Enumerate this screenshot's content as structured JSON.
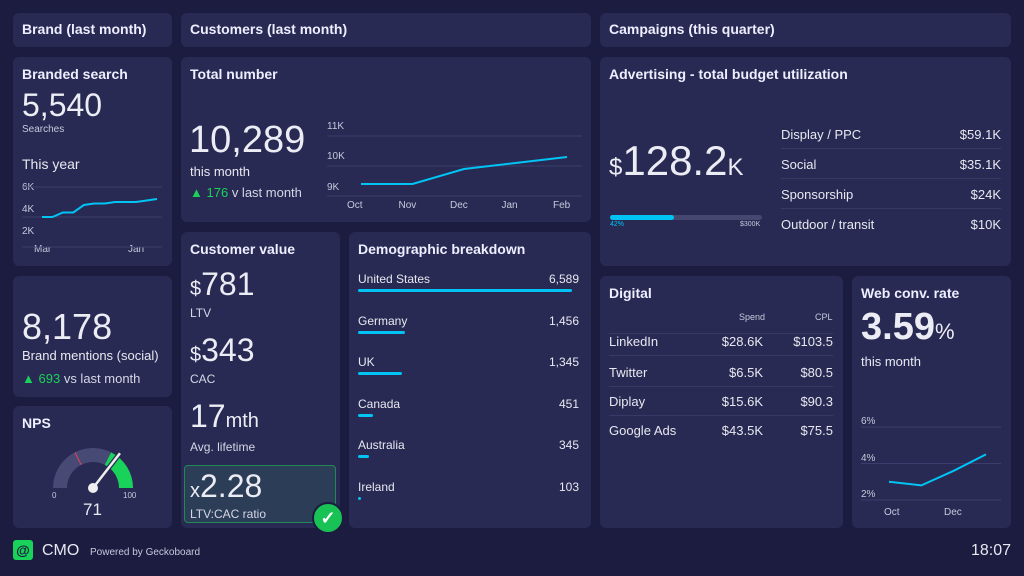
{
  "headers": {
    "brand": "Brand (last month)",
    "customers": "Customers (last month)",
    "campaigns": "Campaigns (this quarter)"
  },
  "branded_search": {
    "title": "Branded search",
    "value": "5,540",
    "unit": "Searches",
    "subtitle": "This year",
    "chart_data": {
      "type": "line",
      "x_labels": [
        "Mar",
        "Jan"
      ],
      "y_ticks": [
        "6K",
        "4K",
        "2K"
      ],
      "ylim": [
        2000,
        6000
      ],
      "values": [
        4000,
        4000,
        4300,
        4300,
        4800,
        4900,
        4900,
        5000,
        5000,
        5000,
        5100,
        5200
      ]
    }
  },
  "brand_mentions": {
    "value": "8,178",
    "label": "Brand mentions (social)",
    "delta": "693",
    "delta_text": "vs last month"
  },
  "nps": {
    "title": "NPS",
    "value": "71",
    "min": "0",
    "max": "100",
    "green_from": 65,
    "red_marker": 35
  },
  "total_number": {
    "title": "Total number",
    "value": "10,289",
    "label": "this month",
    "delta": "176",
    "delta_text": "v last month",
    "chart_data": {
      "type": "line",
      "categories": [
        "Oct",
        "Nov",
        "Dec",
        "Jan",
        "Feb"
      ],
      "y_ticks": [
        "11K",
        "10K",
        "9K"
      ],
      "ylim": [
        9000,
        11000
      ],
      "values": [
        9400,
        9400,
        9900,
        10100,
        10300
      ]
    }
  },
  "customer_value": {
    "title": "Customer value",
    "ltv": "781",
    "ltv_label": "LTV",
    "cac": "343",
    "cac_label": "CAC",
    "lifetime": "17",
    "lifetime_unit": "mth",
    "lifetime_label": "Avg. lifetime",
    "ratio_prefix": "x",
    "ratio": "2.28",
    "ratio_label": "LTV:CAC ratio",
    "currency": "$"
  },
  "demographic": {
    "title": "Demographic breakdown",
    "items": [
      {
        "label": "United States",
        "value": "6,589",
        "n": 6589
      },
      {
        "label": "Germany",
        "value": "1,456",
        "n": 1456
      },
      {
        "label": "UK",
        "value": "1,345",
        "n": 1345
      },
      {
        "label": "Canada",
        "value": "451",
        "n": 451
      },
      {
        "label": "Australia",
        "value": "345",
        "n": 345
      },
      {
        "label": "Ireland",
        "value": "103",
        "n": 103
      }
    ]
  },
  "advertising": {
    "title": "Advertising - total budget utilization",
    "currency": "$",
    "value": "128.2",
    "suffix": "K",
    "progress_pct": 42,
    "progress_label": "42%",
    "target": "$300K",
    "rows": [
      {
        "label": "Display / PPC",
        "value": "$59.1K"
      },
      {
        "label": "Social",
        "value": "$35.1K"
      },
      {
        "label": "Sponsorship",
        "value": "$24K"
      },
      {
        "label": "Outdoor / transit",
        "value": "$10K"
      }
    ]
  },
  "digital": {
    "title": "Digital",
    "columns": [
      "Spend",
      "CPL"
    ],
    "rows": [
      {
        "label": "LinkedIn",
        "spend": "$28.6K",
        "cpl": "$103.5"
      },
      {
        "label": "Twitter",
        "spend": "$6.5K",
        "cpl": "$80.5"
      },
      {
        "label": "Diplay",
        "spend": "$15.6K",
        "cpl": "$90.3"
      },
      {
        "label": "Google Ads",
        "spend": "$43.5K",
        "cpl": "$75.5"
      }
    ]
  },
  "web_conv": {
    "title": "Web conv. rate",
    "value": "3.59",
    "unit": "%",
    "label": "this month",
    "chart_data": {
      "type": "line",
      "x_labels": [
        "Oct",
        "Dec"
      ],
      "y_ticks": [
        "6%",
        "4%",
        "2%"
      ],
      "ylim": [
        2,
        6
      ],
      "values": [
        3.0,
        2.8,
        3.6,
        4.5
      ]
    }
  },
  "footer": {
    "app": "CMO",
    "powered": "Powered by Geckoboard",
    "time": "18:07"
  },
  "colors": {
    "accent": "#00c4f4",
    "green": "#19d25a",
    "card": "#282a53",
    "background": "#1c1b40"
  }
}
